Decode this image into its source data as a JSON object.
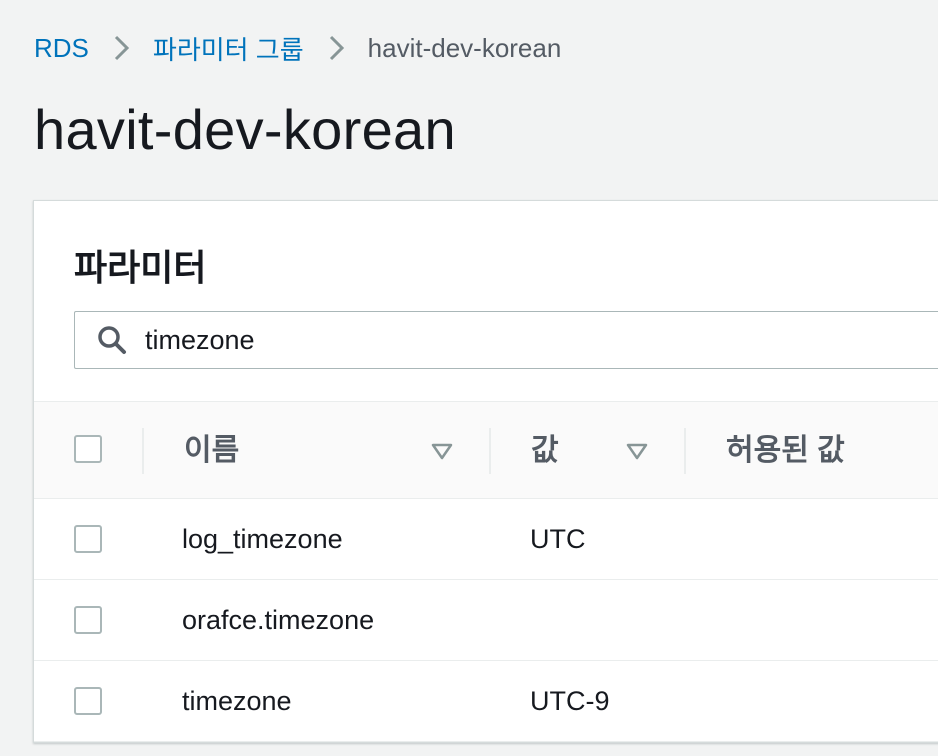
{
  "breadcrumb": {
    "items": [
      "RDS",
      "파라미터 그룹"
    ],
    "current": "havit-dev-korean"
  },
  "page": {
    "title": "havit-dev-korean"
  },
  "panel": {
    "title": "파라미터",
    "search": {
      "value": "timezone",
      "placeholder": ""
    },
    "columns": [
      "이름",
      "값",
      "허용된 값"
    ],
    "rows": [
      {
        "name": "log_timezone",
        "value": "UTC"
      },
      {
        "name": "orafce.timezone",
        "value": ""
      },
      {
        "name": "timezone",
        "value": "UTC-9"
      }
    ]
  },
  "colors": {
    "link": "#0073bb",
    "background": "#f2f3f3",
    "header_text": "#545b64"
  }
}
